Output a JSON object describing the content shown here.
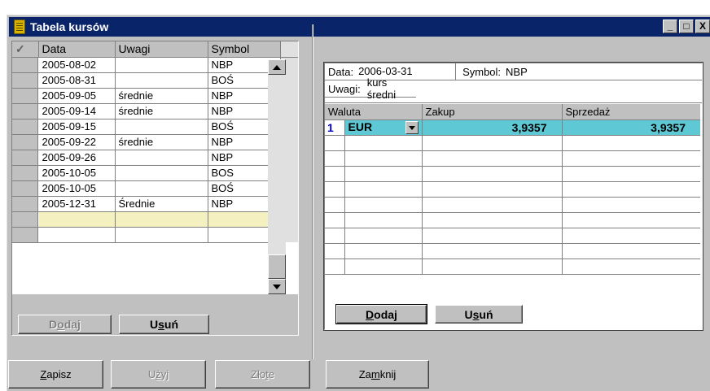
{
  "window": {
    "title": "Tabela kursów",
    "buttons": [
      "_",
      "□",
      "X"
    ]
  },
  "left_grid": {
    "columns": [
      "Data",
      "Uwagi",
      "Symbol"
    ],
    "rows": [
      [
        "2005-08-02",
        "",
        "NBP"
      ],
      [
        "2005-08-31",
        "",
        "BOŚ"
      ],
      [
        "2005-09-05",
        "średnie",
        "NBP"
      ],
      [
        "2005-09-14",
        "średnie",
        "NBP"
      ],
      [
        "2005-09-15",
        "",
        "BOŚ"
      ],
      [
        "2005-09-22",
        "średnie",
        "NBP"
      ],
      [
        "2005-09-26",
        "",
        "NBP"
      ],
      [
        "2005-10-05",
        "",
        "BOS"
      ],
      [
        "2005-10-05",
        "",
        "BOŚ"
      ],
      [
        "2005-12-31",
        "Średnie",
        "NBP"
      ]
    ],
    "add_label_pre": "D",
    "add_label_ul": "o",
    "add_label_post": "daj",
    "del_label_pre": "U",
    "del_label_ul": "s",
    "del_label_post": "uń"
  },
  "details": {
    "date_label": "Data:",
    "date_value": "2006-03-31",
    "symbol_label": "Symbol:",
    "symbol_value": "NBP",
    "notes_label": "Uwagi:",
    "notes_value": "kurs średni"
  },
  "right_grid": {
    "columns": [
      "Waluta",
      "Zakup",
      "Sprzedaż"
    ],
    "rows": [
      {
        "num": "1",
        "currency": "EUR",
        "buy": "3,9357",
        "sell": "3,9357"
      }
    ],
    "add_label_pre": "",
    "add_label_ul": "D",
    "add_label_post": "odaj",
    "del_label_pre": "U",
    "del_label_ul": "s",
    "del_label_post": "uń"
  },
  "bottom_buttons": {
    "save_pre": "",
    "save_ul": "Z",
    "save_post": "apisz",
    "use_pre": "U",
    "use_ul": "ż",
    "use_post": "yj",
    "zlote_pre": "Zło",
    "zlote_ul": "t",
    "zlote_post": "e",
    "close_pre": "Za",
    "close_ul": "m",
    "close_post": "knij"
  },
  "colors": {
    "title_bar": "#0a246a",
    "selected_row": "#5ec8d4",
    "new_row": "#f5f0c0"
  }
}
